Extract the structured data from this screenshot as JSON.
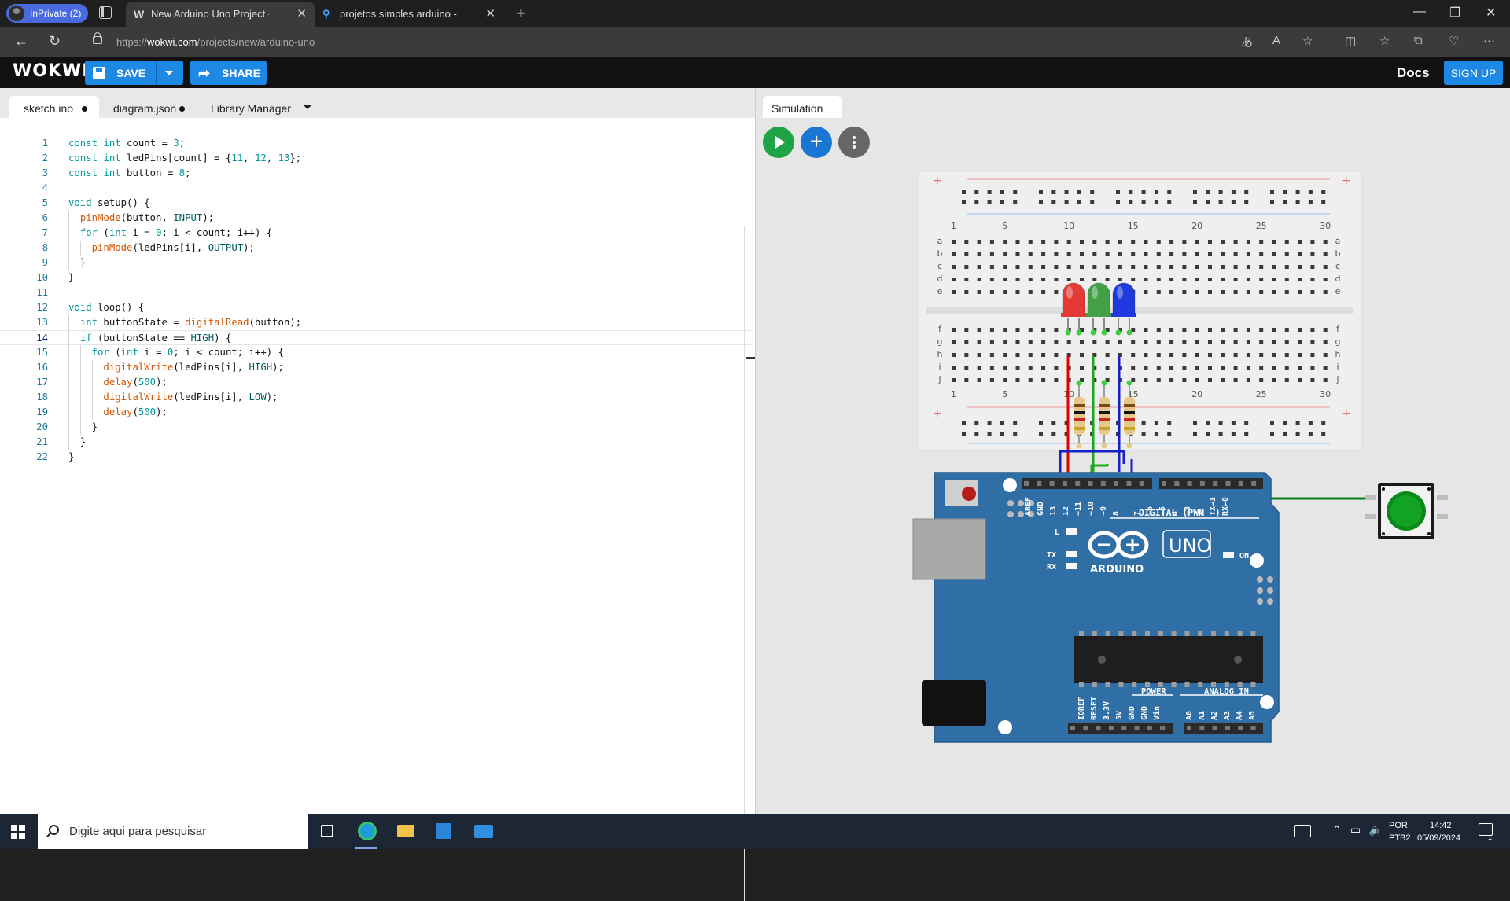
{
  "browser": {
    "profile_label": "InPrivate (2)",
    "tabs": [
      {
        "title": "New Arduino Uno Project - Wokwi",
        "favicon": "W",
        "active": true
      },
      {
        "title": "projetos simples arduino - Pesquisar",
        "favicon": "search-icon",
        "active": false
      }
    ],
    "url_prefix": "https://",
    "url_host": "wokwi.com",
    "url_path": "/projects/new/arduino-uno"
  },
  "header": {
    "logo": "WOKWI",
    "save_label": "SAVE",
    "share_label": "SHARE",
    "docs_label": "Docs",
    "signup_label": "SIGN UP"
  },
  "editor": {
    "tabs": [
      {
        "label": "sketch.ino",
        "modified": true,
        "active": true
      },
      {
        "label": "diagram.json",
        "modified": true,
        "active": false
      },
      {
        "label": "Library Manager",
        "modified": false,
        "active": false
      }
    ],
    "current_line": 14,
    "lines": [
      "const int count = 3;",
      "const int ledPins[count] = {11, 12, 13};",
      "const int button = 8;",
      "",
      "void setup() {",
      "  pinMode(button, INPUT);",
      "  for (int i = 0; i < count; i++) {",
      "    pinMode(ledPins[i], OUTPUT);",
      "  }",
      "}",
      "",
      "void loop() {",
      "  int buttonState = digitalRead(button);",
      "  if (buttonState == HIGH) {",
      "    for (int i = 0; i < count; i++) {",
      "      digitalWrite(ledPins[i], HIGH);",
      "      delay(500);",
      "      digitalWrite(ledPins[i], LOW);",
      "      delay(500);",
      "    }",
      "  }",
      "}"
    ]
  },
  "simulation": {
    "tab_label": "Simulation",
    "breadboard_numbers": [
      "1",
      "5",
      "10",
      "15",
      "20",
      "25",
      "30"
    ],
    "breadboard_rows_top": [
      "a",
      "b",
      "c",
      "d",
      "e"
    ],
    "breadboard_rows_bottom": [
      "f",
      "g",
      "h",
      "i",
      "j"
    ],
    "board": {
      "brand": "ARDUINO",
      "model": "UNO",
      "digital_label": "DIGITAL (PWM ~)",
      "digital_pins": [
        "AREF",
        "GND",
        "13",
        "12",
        "~11",
        "~10",
        "~9",
        "8",
        "7",
        "~6",
        "~5",
        "4",
        "~3",
        "2",
        "TX→1",
        "RX←0"
      ],
      "led_labels": [
        "L",
        "TX",
        "RX",
        "ON"
      ],
      "power_label": "POWER",
      "power_pins": [
        "IOREF",
        "RESET",
        "3.3V",
        "5V",
        "GND",
        "GND",
        "Vin"
      ],
      "analog_label": "ANALOG IN",
      "analog_pins": [
        "A0",
        "A1",
        "A2",
        "A3",
        "A4",
        "A5"
      ]
    },
    "leds": [
      {
        "color": "#e53935",
        "name": "red"
      },
      {
        "color": "#43a047",
        "name": "green"
      },
      {
        "color": "#1e3adf",
        "name": "blue"
      }
    ],
    "wire_colors": {
      "red": "#e00000",
      "green": "#1aa81a",
      "blue": "#1520c8",
      "dark_green": "#0b7a16"
    }
  },
  "taskbar": {
    "search_placeholder": "Digite aqui para pesquisar",
    "lang_top": "POR",
    "lang_bottom": "PTB2",
    "time": "14:42",
    "date": "05/09/2024",
    "notification_count": "1"
  }
}
